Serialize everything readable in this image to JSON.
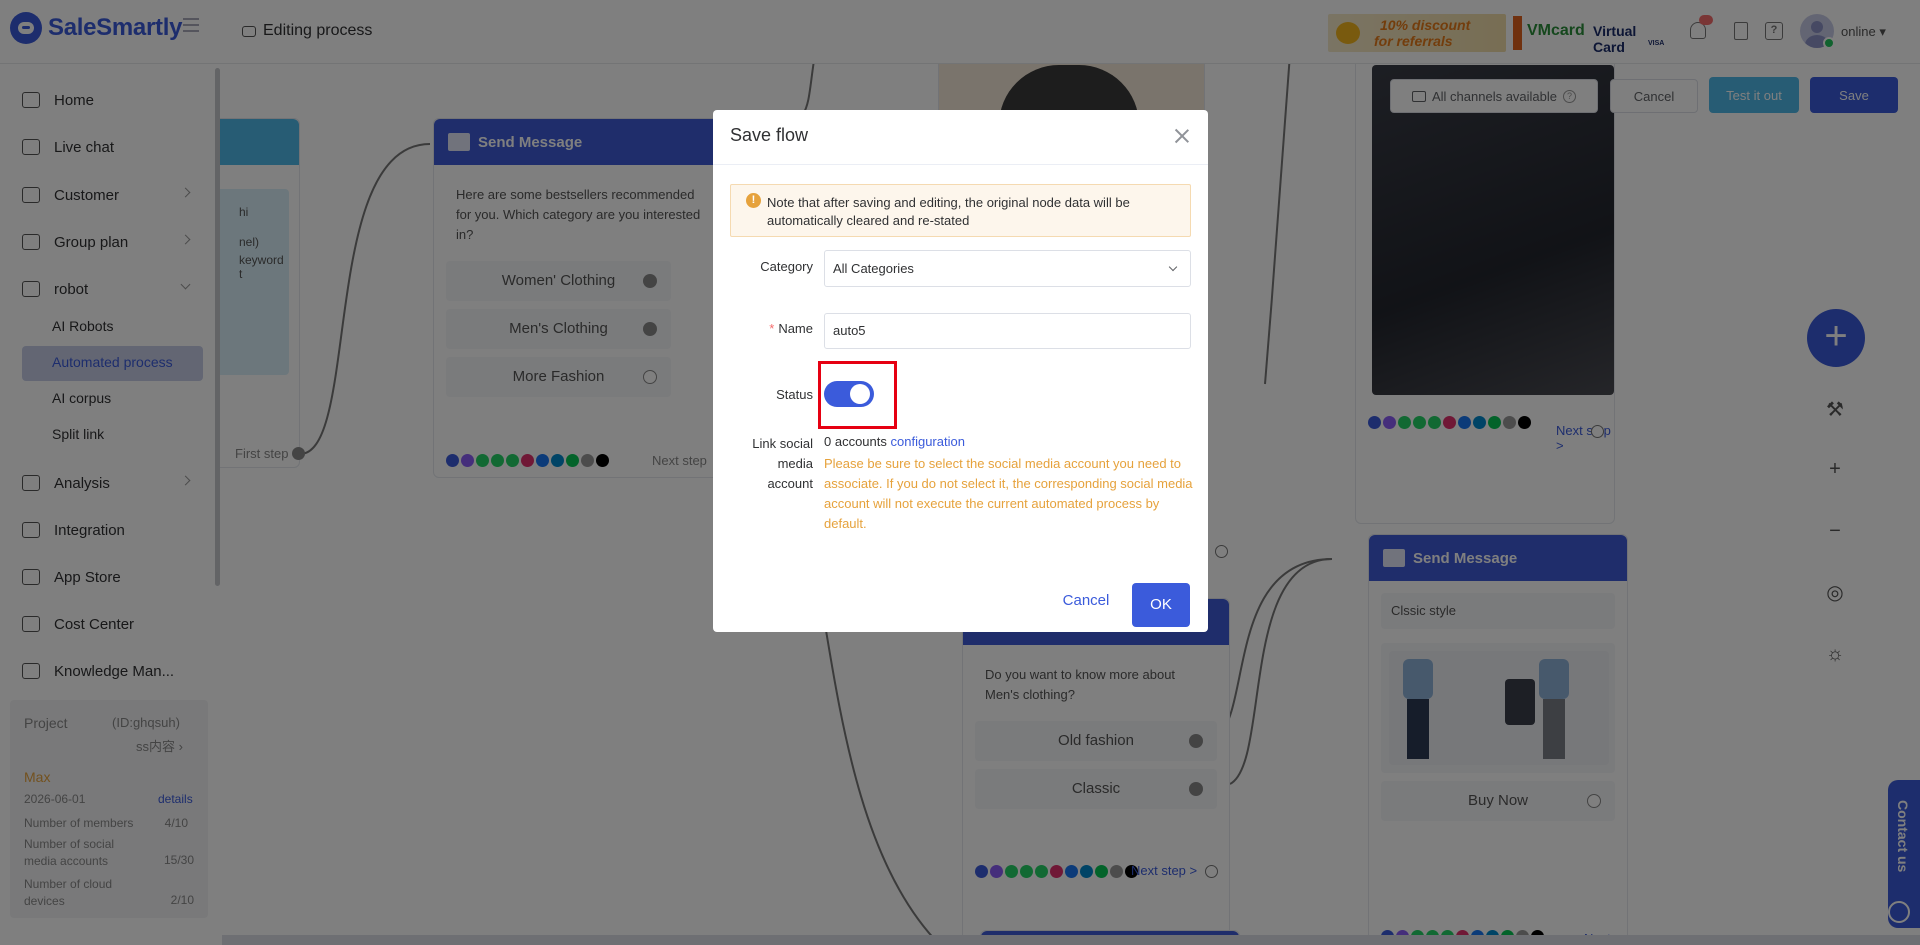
{
  "app": {
    "name": "SaleSmartly"
  },
  "header": {
    "breadcrumb": "Editing process",
    "promo_referral_line1": "10% discount",
    "promo_referral_line2": "for referrals",
    "promo_vmcard_brand": "VMcard",
    "promo_vmcard_label": "Virtual Card",
    "promo_vmcard_sub": "VISA",
    "status": "online"
  },
  "sidebar": {
    "items": [
      {
        "label": "Home"
      },
      {
        "label": "Live chat"
      },
      {
        "label": "Customer"
      },
      {
        "label": "Group plan"
      },
      {
        "label": "robot"
      },
      {
        "label": "Analysis"
      },
      {
        "label": "Integration"
      },
      {
        "label": "App Store"
      },
      {
        "label": "Cost Center"
      },
      {
        "label": "Knowledge Man..."
      }
    ],
    "robot_sub": [
      {
        "label": "AI Robots"
      },
      {
        "label": "Automated process"
      },
      {
        "label": "AI corpus"
      },
      {
        "label": "Split link"
      }
    ],
    "project": {
      "title": "Project",
      "id": "(ID:ghqsuh)",
      "name": "ss内容",
      "plan": "Max",
      "expiry": "2026-06-01",
      "details_link": "details",
      "stats": [
        {
          "label": "Number of members",
          "value": "4/10"
        },
        {
          "label": "Number of social media accounts",
          "value": "15/30"
        },
        {
          "label": "Number of cloud devices",
          "value": "2/10"
        }
      ]
    }
  },
  "toolbar": {
    "channels_label": "All channels available",
    "cancel_label": "Cancel",
    "test_label": "Test it out",
    "save_label": "Save"
  },
  "canvas": {
    "first_step_label": "First step",
    "left_node_text_lines": [
      "hi",
      "nel)",
      "keyword t"
    ],
    "node1": {
      "title": "Send Message",
      "text": "Here are some bestsellers recommended for you. Which category are you interested in?",
      "options": [
        "Women' Clothing",
        "Men's Clothing",
        "More Fashion"
      ],
      "next_step": "Next step"
    },
    "node2": {
      "text": "Do you want to know more about Men's clothing?",
      "options": [
        "Old fashion",
        "Classic"
      ],
      "next_step": "Next step >"
    },
    "node3": {
      "next_step": "Next step >"
    },
    "node4": {
      "title": "Send Message",
      "text": "Clssic style",
      "option": "Buy Now",
      "next_step": "Next step >"
    },
    "social_colors": [
      "#3b5bdb",
      "#8a5cf6",
      "#25d366",
      "#25d366",
      "#25d366",
      "#e1306c",
      "#1877f2",
      "#0088cc",
      "#06c755",
      "#999999",
      "#000000"
    ]
  },
  "contact": {
    "label": "Contact us"
  },
  "modal": {
    "title": "Save flow",
    "notice": "Note that after saving and editing, the original node data will be automatically cleared and re-stated",
    "category_label": "Category",
    "category_value": "All Categories",
    "name_label": "Name",
    "name_value": "auto5",
    "status_label": "Status",
    "status_on": true,
    "link_label_line1": "Link social",
    "link_label_line2": "media",
    "link_label_line3": "account",
    "accounts_text": "0 accounts",
    "configuration_link": "configuration",
    "account_warning": "Please be sure to select the social media account you need to associate. If you do not select it, the corresponding social media account will not execute the current automated process by default.",
    "cancel_label": "Cancel",
    "ok_label": "OK"
  }
}
